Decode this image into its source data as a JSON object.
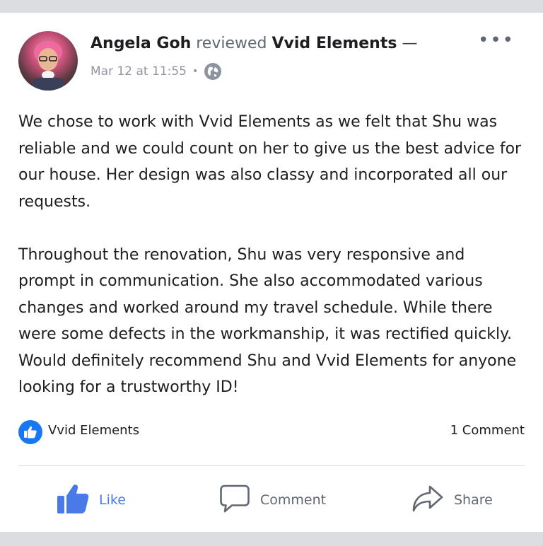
{
  "post": {
    "author": "Angela Goh",
    "verb": "reviewed",
    "page_name": "Vvid Elements",
    "dash": "—",
    "timestamp": "Mar 12 at 11:55",
    "separator": "•",
    "privacy_icon": "globe-icon",
    "more_icon": "•••",
    "paragraphs": [
      "We chose to work with Vvid Elements as we felt that Shu was reliable and we could count on her to give us the best advice for our house. Her design was also classy and incorporated all our requests.",
      "Throughout the renovation, Shu was very responsive and prompt in communication. She also accommodated various changes and worked around my travel schedule. While there were some defects in the workmanship, it was rectified quickly. Would definitely recommend Shu and Vvid Elements for anyone looking for a trustworthy ID!"
    ]
  },
  "stats": {
    "reaction_icon": "like-icon",
    "reaction_names": "Vvid Elements",
    "comments": "1 Comment"
  },
  "actions": {
    "like": "Like",
    "comment": "Comment",
    "share": "Share"
  },
  "colors": {
    "accent": "#1877f2",
    "like_text": "#4a79e8",
    "muted": "#606770"
  }
}
